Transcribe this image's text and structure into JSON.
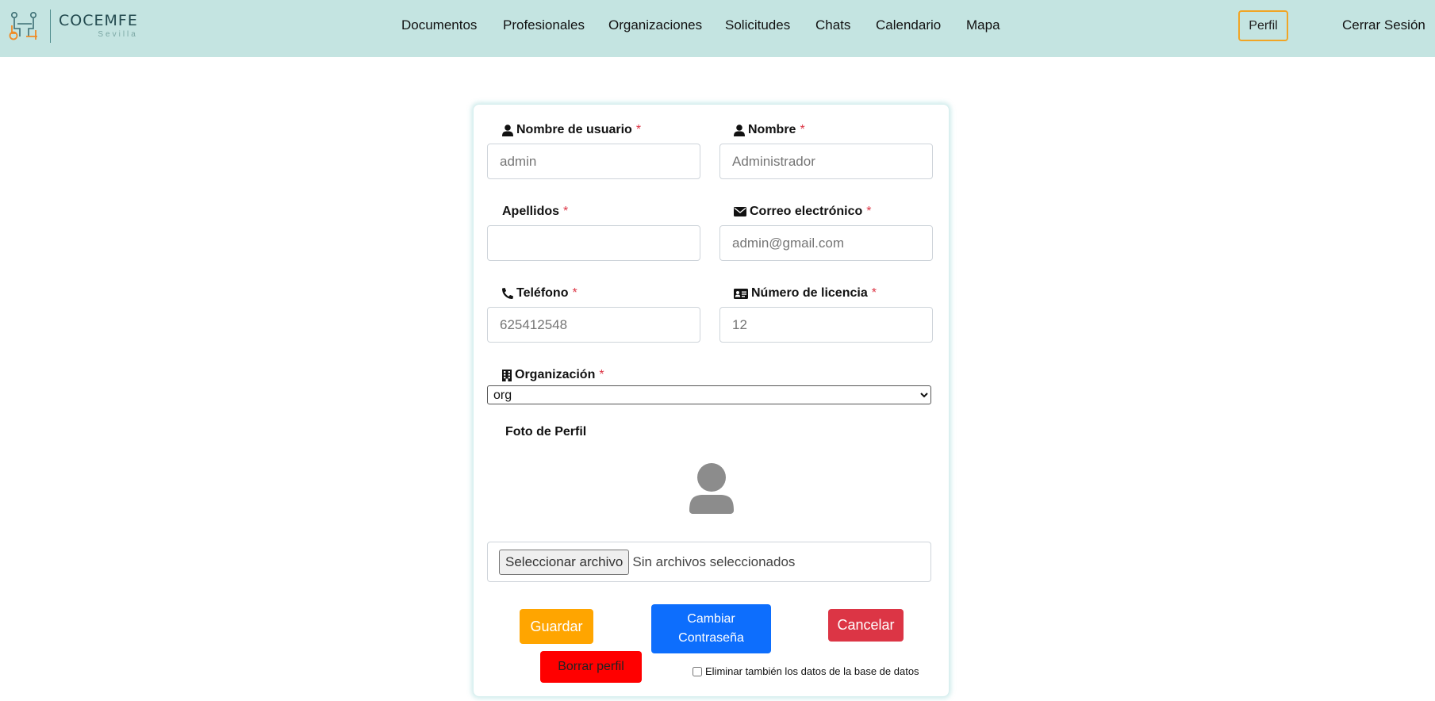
{
  "header": {
    "logo": {
      "name": "COCEMFE",
      "subtitle": "Sevilla"
    },
    "nav": [
      {
        "label": "Documentos"
      },
      {
        "label": "Profesionales"
      },
      {
        "label": "Organizaciones"
      },
      {
        "label": "Solicitudes"
      },
      {
        "label": "Chats"
      },
      {
        "label": "Calendario"
      },
      {
        "label": "Mapa"
      }
    ],
    "profile_label": "Perfil",
    "logout_label": "Cerrar Sesión"
  },
  "form": {
    "required_mark": "*",
    "username": {
      "label": "Nombre de usuario",
      "placeholder": "admin",
      "value": ""
    },
    "first_name": {
      "label": "Nombre",
      "placeholder": "Administrador",
      "value": ""
    },
    "last_name": {
      "label": "Apellidos",
      "placeholder": "",
      "value": ""
    },
    "email": {
      "label": "Correo electrónico",
      "placeholder": "admin@gmail.com",
      "value": ""
    },
    "phone": {
      "label": "Teléfono",
      "placeholder": "625412548",
      "value": ""
    },
    "license": {
      "label": "Número de licencia",
      "placeholder": "12",
      "value": ""
    },
    "organization": {
      "label": "Organización",
      "selected": "org"
    },
    "photo": {
      "label": "Foto de Perfil",
      "file_button": "Seleccionar archivo",
      "file_status": "Sin archivos seleccionados"
    },
    "buttons": {
      "save": "Guardar",
      "change_password": "Cambiar Contraseña",
      "cancel": "Cancelar",
      "delete_profile": "Borrar perfil"
    },
    "also_delete_label": "Eliminar también los datos de la base de datos"
  },
  "colors": {
    "navbar_bg": "#c4e4e1",
    "profile_border": "#f1a525",
    "save": "#ffa500",
    "change_password": "#0d6efd",
    "cancel": "#dc3545",
    "delete": "#ff0000",
    "required": "#dc3545"
  },
  "icons": {
    "username": "user-icon",
    "first_name": "user-icon",
    "email": "envelope-icon",
    "phone": "phone-icon",
    "license": "id-card-icon",
    "organization": "building-icon",
    "avatar": "avatar-placeholder-icon"
  }
}
